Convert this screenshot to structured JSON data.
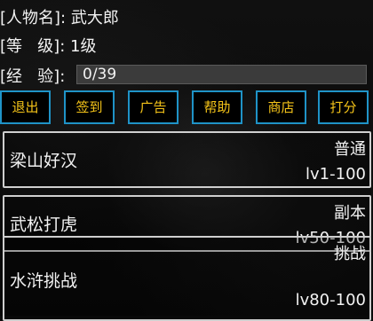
{
  "profile": {
    "name_label": "[人物名]: ",
    "name_value": "武大郎",
    "level_label": "[等   级]: ",
    "level_value": "1级",
    "exp_label": "[经   验]: ",
    "exp_text": "0/39",
    "exp_fraction": 0
  },
  "buttons": [
    {
      "label": "退出"
    },
    {
      "label": "签到"
    },
    {
      "label": "广告"
    },
    {
      "label": "帮助"
    },
    {
      "label": "商店"
    },
    {
      "label": "打分"
    }
  ],
  "levels": [
    {
      "title": "梁山好汉",
      "type": "普通",
      "range": "lv1-100"
    },
    {
      "title": "武松打虎",
      "type": "副本",
      "range": "lv50-100"
    },
    {
      "title": "水浒挑战",
      "type": "挑战",
      "range": "lv80-100"
    }
  ],
  "colors": {
    "button_border": "#1f93c7",
    "button_text": "#f5c419",
    "card_border": "#cfcfcf",
    "exp_track": "#3b3b3b"
  }
}
